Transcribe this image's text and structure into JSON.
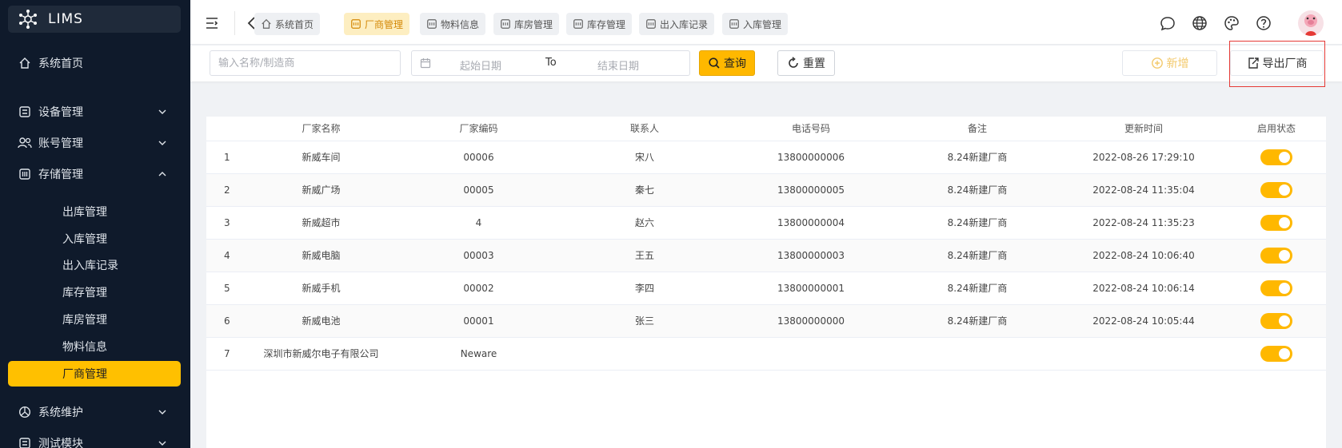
{
  "app": {
    "name": "LIMS"
  },
  "sidebar": {
    "items": [
      {
        "label": "系统首页",
        "icon": "home-icon"
      },
      {
        "label": "设备管理",
        "icon": "device-icon",
        "expanded": false
      },
      {
        "label": "账号管理",
        "icon": "users-icon",
        "expanded": false
      },
      {
        "label": "存储管理",
        "icon": "storage-icon",
        "expanded": true
      },
      {
        "label": "系统维护",
        "icon": "maintenance-icon",
        "expanded": false
      },
      {
        "label": "测试模块",
        "icon": "test-module-icon",
        "expanded": false
      }
    ],
    "sub_items": [
      {
        "label": "出库管理"
      },
      {
        "label": "入库管理"
      },
      {
        "label": "出入库记录"
      },
      {
        "label": "库存管理"
      },
      {
        "label": "库房管理"
      },
      {
        "label": "物料信息"
      },
      {
        "label": "厂商管理",
        "active": true
      }
    ]
  },
  "tabs": [
    {
      "label": "系统首页",
      "icon": "home-icon"
    },
    {
      "label": "厂商管理",
      "icon": "vendor-icon",
      "active": true
    },
    {
      "label": "物料信息",
      "icon": "material-icon"
    },
    {
      "label": "库房管理",
      "icon": "warehouse-icon"
    },
    {
      "label": "库存管理",
      "icon": "inventory-icon"
    },
    {
      "label": "出入库记录",
      "icon": "record-icon"
    },
    {
      "label": "入库管理",
      "icon": "inbound-icon"
    }
  ],
  "toolbar": {
    "search_placeholder": "输入名称/制造商",
    "date_start_placeholder": "起始日期",
    "date_separator": "To",
    "date_end_placeholder": "结束日期",
    "query_label": "查询",
    "reset_label": "重置",
    "add_label": "新增",
    "export_label": "导出厂商"
  },
  "table": {
    "columns": [
      "",
      "厂家名称",
      "厂家编码",
      "联系人",
      "电话号码",
      "备注",
      "更新时间",
      "启用状态"
    ],
    "rows": [
      {
        "index": "1",
        "name": "新威车间",
        "code": "00006",
        "contact": "宋八",
        "phone": "13800000006",
        "remark": "8.24新建厂商",
        "updated": "2022-08-26 17:29:10",
        "enabled": true
      },
      {
        "index": "2",
        "name": "新威广场",
        "code": "00005",
        "contact": "秦七",
        "phone": "13800000005",
        "remark": "8.24新建厂商",
        "updated": "2022-08-24 11:35:04",
        "enabled": true
      },
      {
        "index": "3",
        "name": "新威超市",
        "code": "4",
        "contact": "赵六",
        "phone": "13800000004",
        "remark": "8.24新建厂商",
        "updated": "2022-08-24 11:35:23",
        "enabled": true
      },
      {
        "index": "4",
        "name": "新威电脑",
        "code": "00003",
        "contact": "王五",
        "phone": "13800000003",
        "remark": "8.24新建厂商",
        "updated": "2022-08-24 10:06:40",
        "enabled": true
      },
      {
        "index": "5",
        "name": "新威手机",
        "code": "00002",
        "contact": "李四",
        "phone": "13800000001",
        "remark": "8.24新建厂商",
        "updated": "2022-08-24 10:06:14",
        "enabled": true
      },
      {
        "index": "6",
        "name": "新威电池",
        "code": "00001",
        "contact": "张三",
        "phone": "13800000000",
        "remark": "8.24新建厂商",
        "updated": "2022-08-24 10:05:44",
        "enabled": true
      },
      {
        "index": "7",
        "name": "深圳市新威尔电子有限公司",
        "code": "Neware",
        "contact": "",
        "phone": "",
        "remark": "",
        "updated": "",
        "enabled": true
      }
    ]
  },
  "colors": {
    "accent": "#ffb800",
    "sidebar_bg": "#0f1a2b",
    "highlight": "#e53935"
  }
}
